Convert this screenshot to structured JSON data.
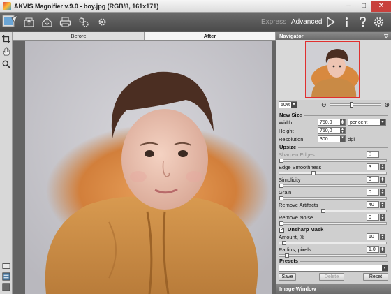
{
  "window": {
    "title": "AKVIS Magnifier v.9.0 - boy.jpg (RGB/8, 161x171)"
  },
  "toolbar": {
    "modes": {
      "express": "Express",
      "advanced": "Advanced"
    }
  },
  "tabs": [
    {
      "label": "Before"
    },
    {
      "label": "After"
    }
  ],
  "navigator": {
    "title": "Navigator",
    "zoom": "50%"
  },
  "new_size": {
    "title": "New Size",
    "width_label": "Width",
    "width_value": "750,0",
    "height_label": "Height",
    "height_value": "750,0",
    "unit": "per cent",
    "resolution_label": "Resolution",
    "resolution_value": "300",
    "resolution_unit": "dpi"
  },
  "upsize": {
    "title": "Upsize",
    "sharpen_edges": {
      "label": "Sharpen Edges",
      "value": "0"
    },
    "edge_smoothness": {
      "label": "Edge Smoothness",
      "value": "3"
    },
    "simplicity": {
      "label": "Simplicity",
      "value": "0"
    },
    "grain": {
      "label": "Grain",
      "value": "0"
    },
    "remove_artifacts": {
      "label": "Remove Artifacts",
      "value": "40"
    },
    "remove_noise": {
      "label": "Remove Noise",
      "value": "0"
    }
  },
  "unsharp": {
    "title": "Unsharp Mask",
    "checked": "✓",
    "amount": {
      "label": "Amount, %",
      "value": "10"
    },
    "radius": {
      "label": "Radius, pixels",
      "value": "1,0"
    }
  },
  "presets": {
    "title": "Presets",
    "save": "Save",
    "delete": "Delete",
    "reset": "Reset"
  },
  "image_window": {
    "title": "Image Window"
  },
  "colors": {
    "toolbar": "#555555",
    "panel": "#cfcfcf",
    "close": "#c8403c"
  }
}
